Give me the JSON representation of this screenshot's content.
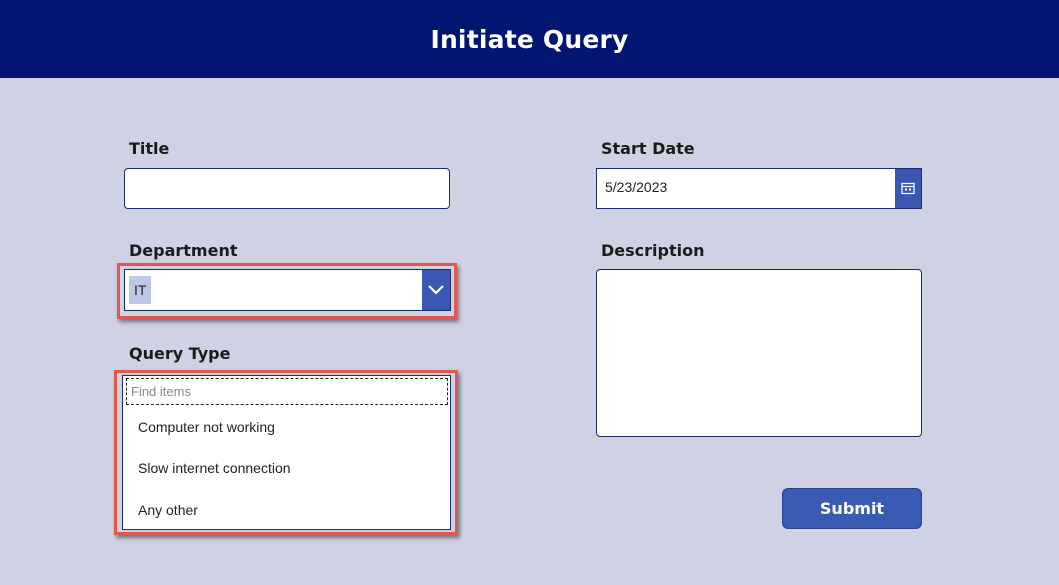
{
  "header": {
    "title": "Initiate Query"
  },
  "form": {
    "title_label": "Title",
    "title_value": "",
    "department_label": "Department",
    "department_value": "IT",
    "query_type_label": "Query Type",
    "query_type_placeholder": "Find items",
    "query_type_options": [
      "Computer not working",
      "Slow internet connection",
      "Any other"
    ],
    "start_date_label": "Start Date",
    "start_date_value": "5/23/2023",
    "description_label": "Description",
    "description_value": "",
    "submit_label": "Submit"
  },
  "colors": {
    "header_bg": "#021570",
    "page_bg": "#cfd2e3",
    "accent": "#3a58b1",
    "highlight": "#e3584e"
  }
}
